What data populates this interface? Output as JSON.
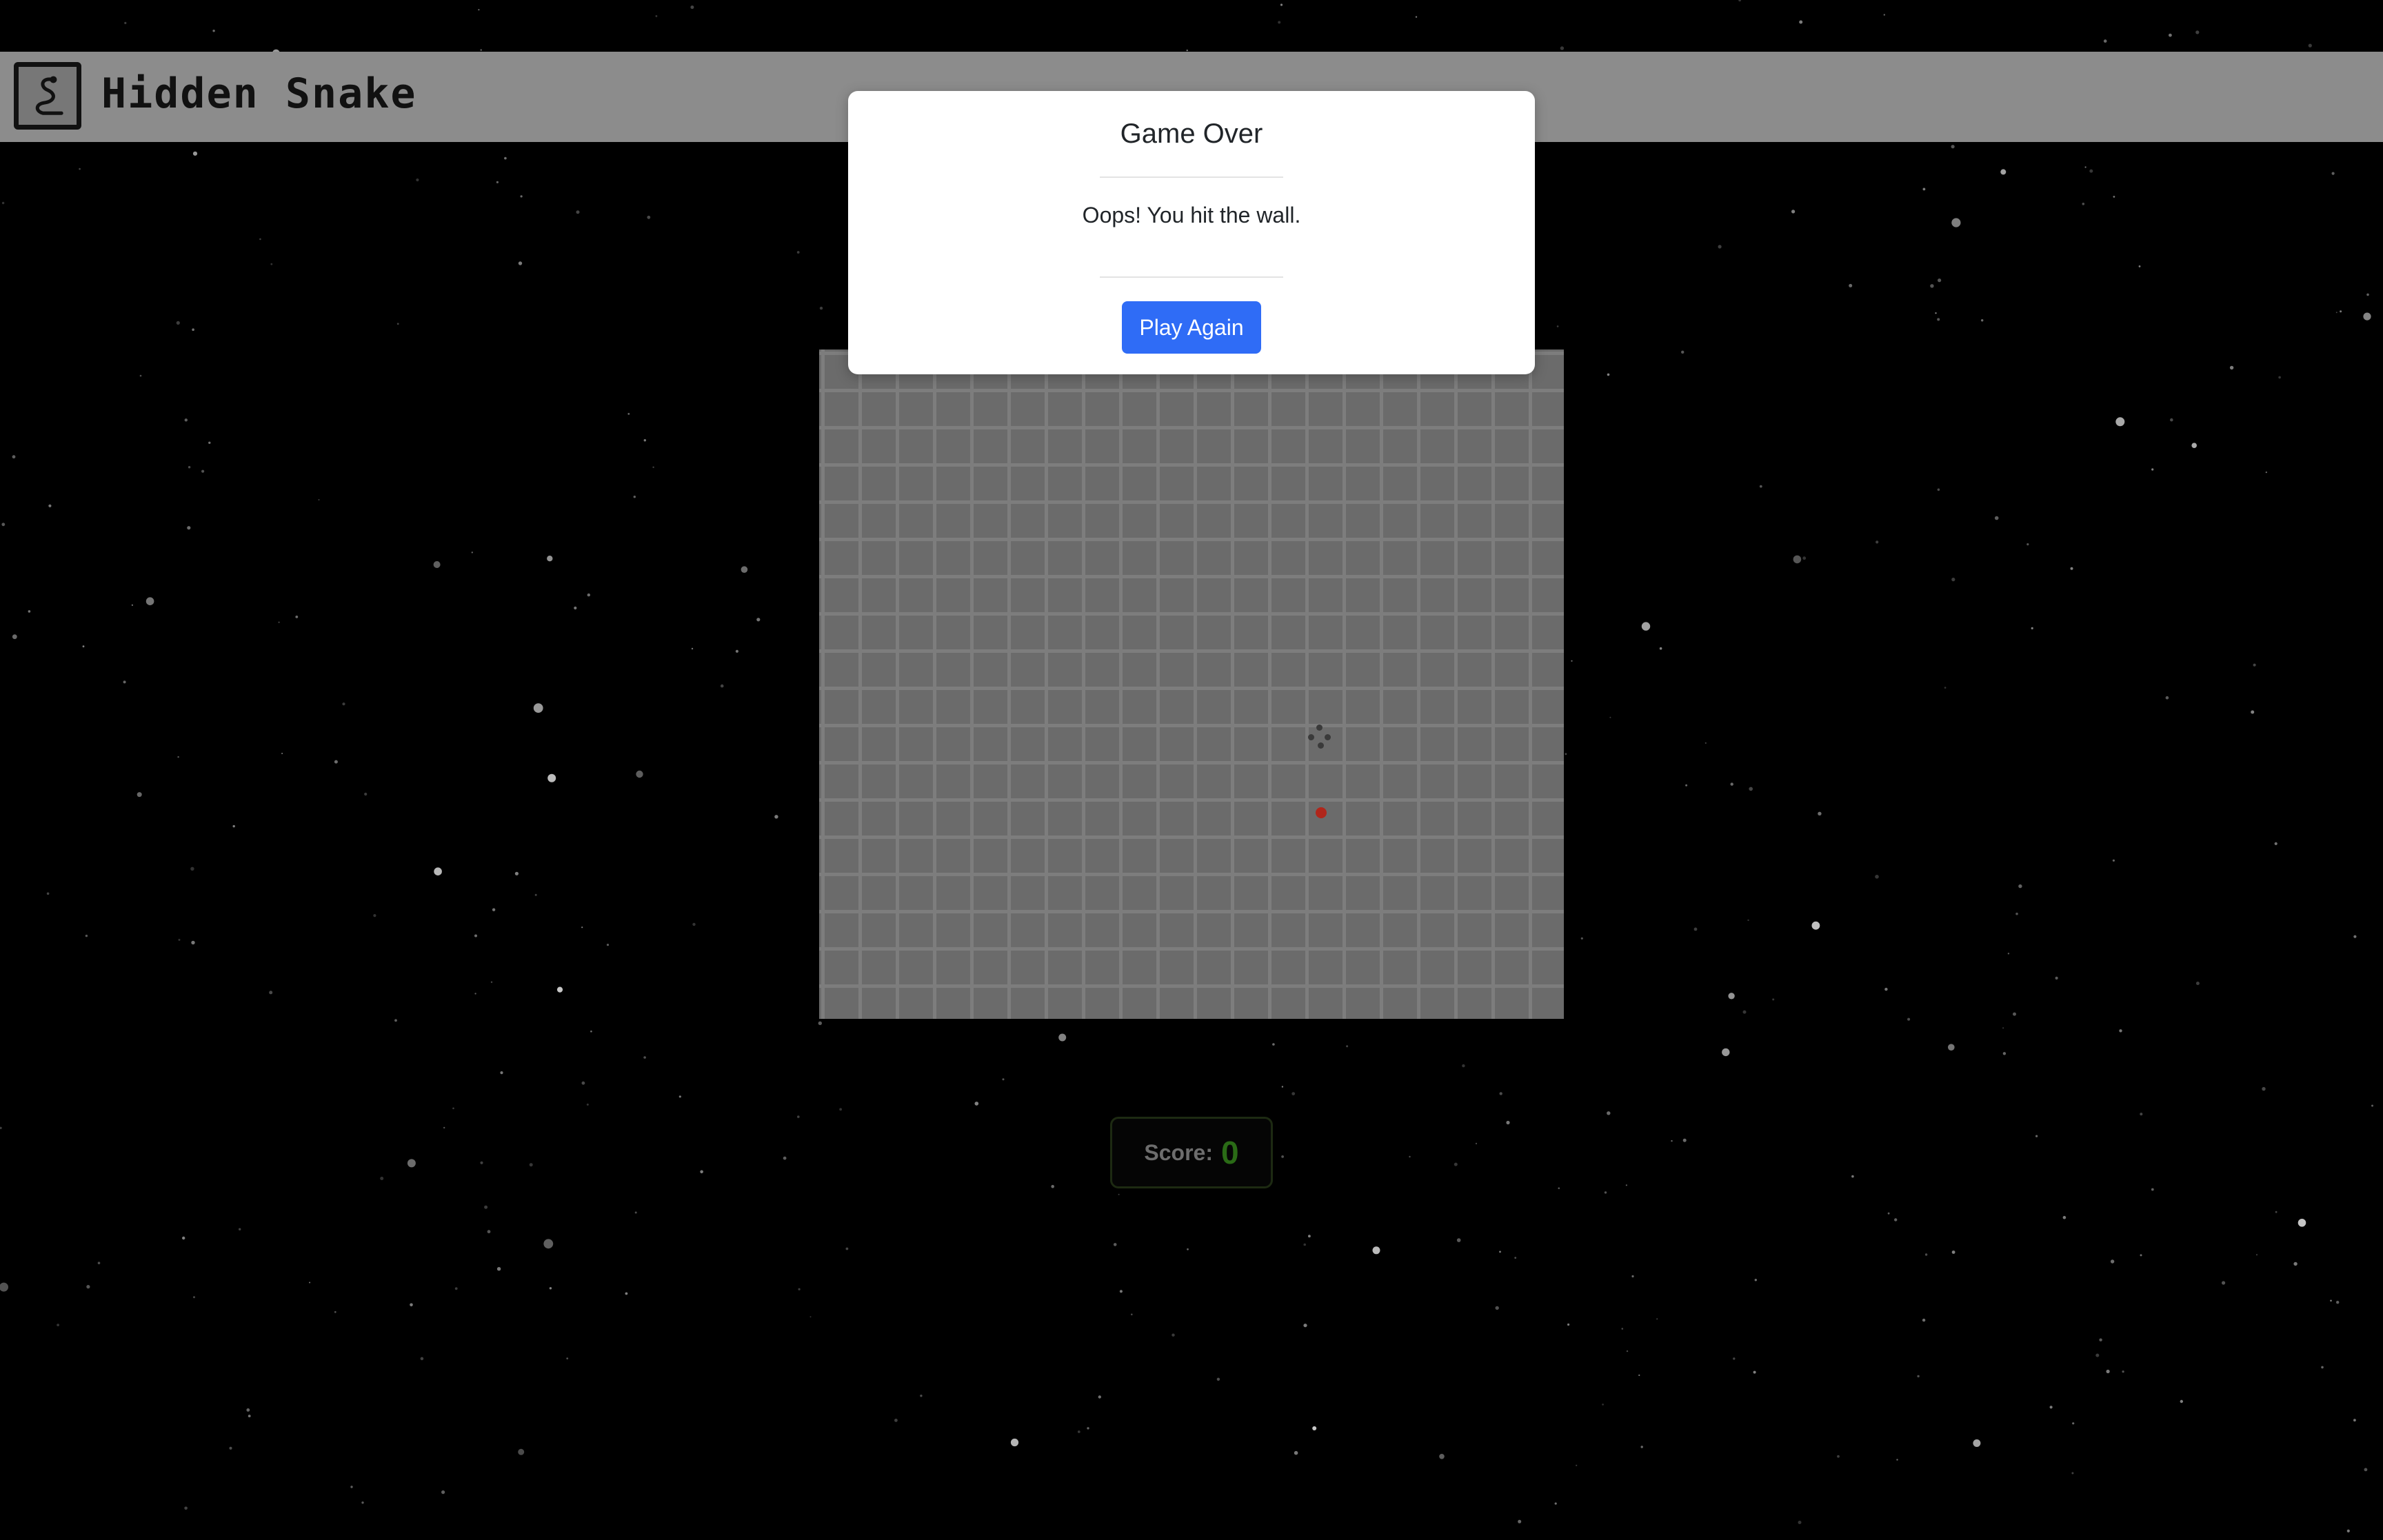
{
  "header": {
    "brand_name": "Hidden Snake",
    "logo_icon": "snake-icon"
  },
  "game": {
    "food_color": "#b0261b",
    "board_color": "#6b6b6b"
  },
  "score": {
    "label": "Score:",
    "value": "0",
    "value_color": "#2a6b16"
  },
  "modal": {
    "title": "Game Over",
    "message": "Oops! You hit the wall.",
    "button_label": "Play Again",
    "button_color": "#2f6cf6"
  }
}
